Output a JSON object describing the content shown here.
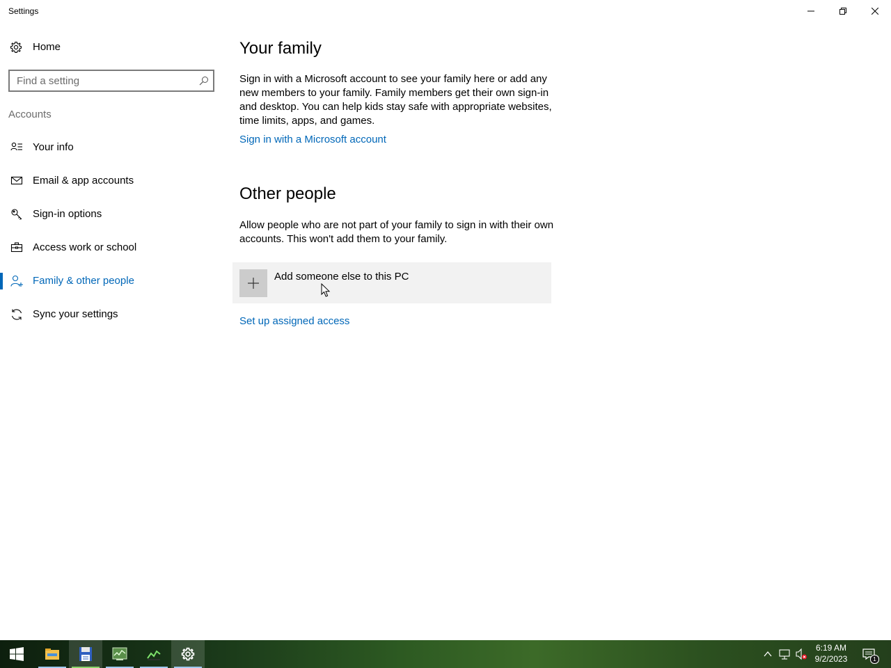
{
  "window": {
    "title": "Settings"
  },
  "sidebar": {
    "home_label": "Home",
    "search_placeholder": "Find a setting",
    "section_label": "Accounts",
    "items": [
      {
        "label": "Your info",
        "icon": "user-card-icon"
      },
      {
        "label": "Email & app accounts",
        "icon": "mail-icon"
      },
      {
        "label": "Sign-in options",
        "icon": "key-icon"
      },
      {
        "label": "Access work or school",
        "icon": "briefcase-icon"
      },
      {
        "label": "Family & other people",
        "icon": "person-add-icon",
        "selected": true
      },
      {
        "label": "Sync your settings",
        "icon": "sync-icon"
      }
    ]
  },
  "main": {
    "family_title": "Your family",
    "family_text": "Sign in with a Microsoft account to see your family here or add any new members to your family. Family members get their own sign-in and desktop. You can help kids stay safe with appropriate websites, time limits, apps, and games.",
    "family_link": "Sign in with a Microsoft account",
    "other_title": "Other people",
    "other_text": "Allow people who are not part of your family to sign in with their own accounts. This won't add them to your family.",
    "add_button_label": "Add someone else to this PC",
    "assigned_access_link": "Set up assigned access"
  },
  "taskbar": {
    "apps": [
      "start-icon",
      "file-explorer-icon",
      "save-disk-icon",
      "task-manager-icon",
      "chart-app-icon",
      "settings-gear-icon"
    ],
    "time": "6:19 AM",
    "date": "9/2/2023",
    "notification_count": "1"
  },
  "colors": {
    "accent": "#0067b8",
    "tile_bg": "#f2f2f2"
  }
}
